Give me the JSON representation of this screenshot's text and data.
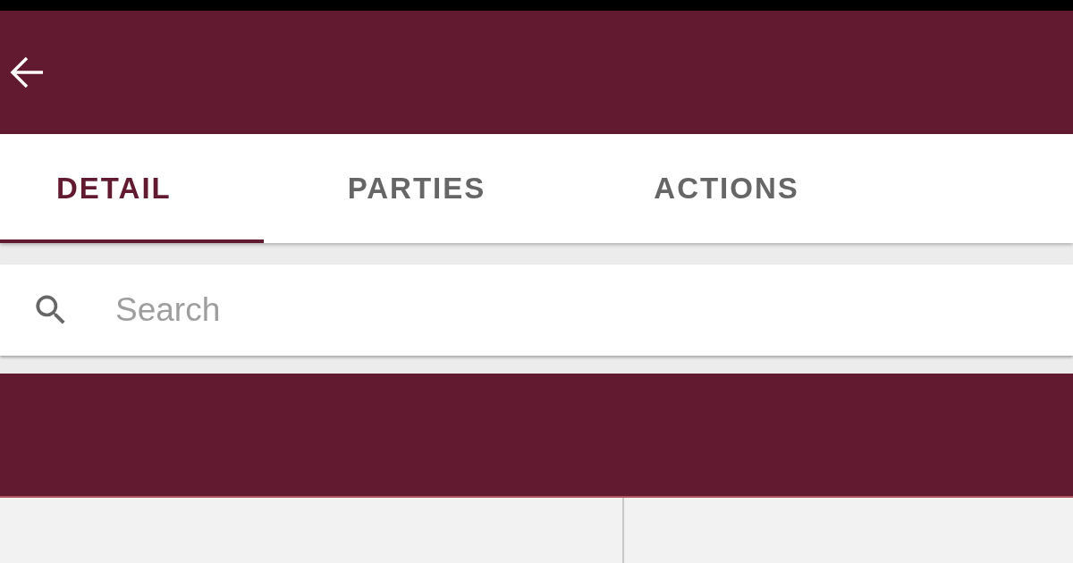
{
  "tabs": [
    {
      "label": "DETAIL",
      "selected": true
    },
    {
      "label": "PARTIES",
      "selected": false
    },
    {
      "label": "ACTIONS",
      "selected": false
    }
  ],
  "search": {
    "placeholder": "Search"
  }
}
